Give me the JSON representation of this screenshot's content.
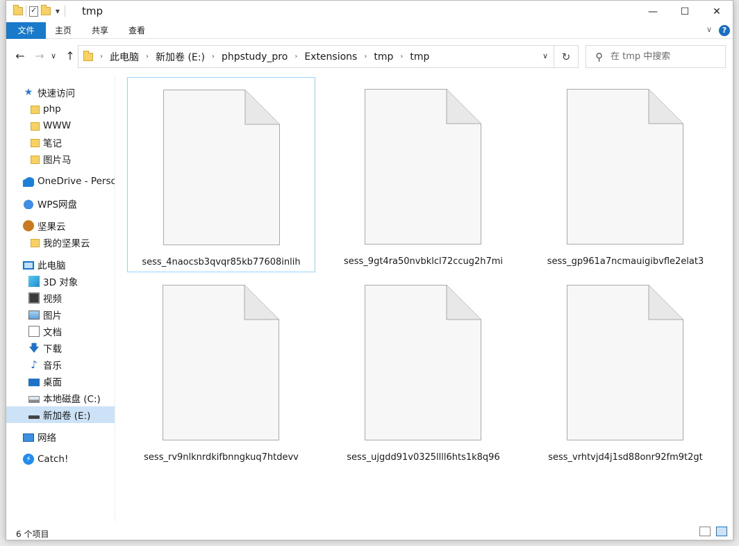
{
  "window": {
    "title": "tmp",
    "minimize_glyph": "—",
    "maximize_glyph": "☐",
    "close_glyph": "✕"
  },
  "ribbon": {
    "tabs": [
      {
        "label": "文件",
        "active": true
      },
      {
        "label": "主页",
        "active": false
      },
      {
        "label": "共享",
        "active": false
      },
      {
        "label": "查看",
        "active": false
      }
    ],
    "help_label": "?"
  },
  "address": {
    "crumbs": [
      "此电脑",
      "新加卷 (E:)",
      "phpstudy_pro",
      "Extensions",
      "tmp",
      "tmp"
    ]
  },
  "search": {
    "placeholder": "在 tmp 中搜索"
  },
  "nav": {
    "items": [
      {
        "label": "快速访问",
        "icon": "star-icon"
      },
      {
        "label": "php",
        "icon": "folder-icon"
      },
      {
        "label": "WWW",
        "icon": "folder-icon"
      },
      {
        "label": "笔记",
        "icon": "folder-icon"
      },
      {
        "label": "图片马",
        "icon": "folder-icon"
      },
      {
        "label": "OneDrive - Persc",
        "icon": "onedrive-icon"
      },
      {
        "label": "WPS网盘",
        "icon": "wps-cloud-icon"
      },
      {
        "label": "坚果云",
        "icon": "nutstore-icon"
      },
      {
        "label": "我的坚果云",
        "icon": "folder-icon"
      },
      {
        "label": "此电脑",
        "icon": "computer-icon"
      },
      {
        "label": "3D 对象",
        "icon": "3d-objects-icon"
      },
      {
        "label": "视频",
        "icon": "video-icon"
      },
      {
        "label": "图片",
        "icon": "pictures-icon"
      },
      {
        "label": "文档",
        "icon": "documents-icon"
      },
      {
        "label": "下载",
        "icon": "download-icon"
      },
      {
        "label": "音乐",
        "icon": "music-icon"
      },
      {
        "label": "桌面",
        "icon": "desktop-icon"
      },
      {
        "label": "本地磁盘 (C:)",
        "icon": "drive-c-icon"
      },
      {
        "label": "新加卷 (E:)",
        "icon": "drive-e-icon",
        "selected": true
      },
      {
        "label": "网络",
        "icon": "network-icon"
      },
      {
        "label": "Catch!",
        "icon": "catch-icon"
      }
    ]
  },
  "files": [
    {
      "name": "sess_4naocsb3qvqr85kb77608inlih",
      "selected": true
    },
    {
      "name": "sess_9gt4ra50nvbklcl72ccug2h7mi",
      "selected": false
    },
    {
      "name": "sess_gp961a7ncmauigibvfle2elat3",
      "selected": false
    },
    {
      "name": "sess_rv9nlknrdkifbnngkuq7htdevv",
      "selected": false
    },
    {
      "name": "sess_ujgdd91v0325llll6hts1k8q96",
      "selected": false
    },
    {
      "name": "sess_vrhtvjd4j1sd88onr92fm9t2gt",
      "selected": false
    }
  ],
  "status": {
    "item_count": "6 个项目"
  },
  "colors": {
    "accent": "#1979ca",
    "selection": "#cce3f7",
    "folder": "#f7d166"
  }
}
